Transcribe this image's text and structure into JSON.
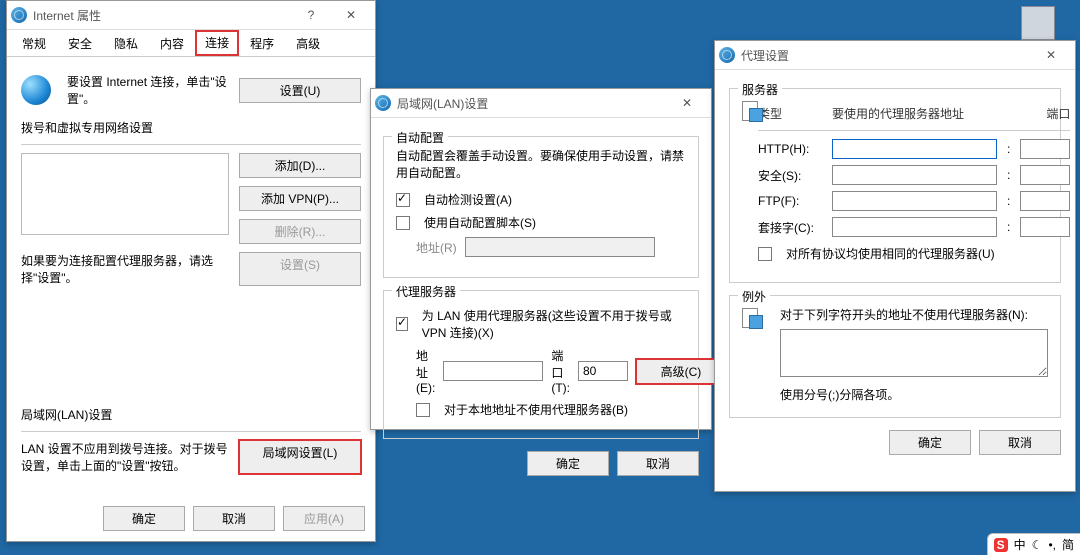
{
  "internet": {
    "title": "Internet 属性",
    "tabs": {
      "general": "常规",
      "security": "安全",
      "privacy": "隐私",
      "content": "内容",
      "connections": "连接",
      "programs": "程序",
      "advanced": "高级"
    },
    "conn_line": "要设置 Internet 连接，单击\"设置\"。",
    "settings_btn": "设置(U)",
    "dial_heading": "拨号和虚拟专用网络设置",
    "add_btn": "添加(D)...",
    "add_vpn_btn": "添加 VPN(P)...",
    "remove_btn": "删除(R)...",
    "settings_s_btn": "设置(S)",
    "proxy_note": "如果要为连接配置代理服务器，请选择\"设置\"。",
    "lan_heading": "局域网(LAN)设置",
    "lan_note": "LAN 设置不应用到拨号连接。对于拨号设置，单击上面的\"设置\"按钮。",
    "lan_btn": "局域网设置(L)",
    "ok": "确定",
    "cancel": "取消",
    "apply": "应用(A)"
  },
  "lan": {
    "title": "局域网(LAN)设置",
    "auto_group": "自动配置",
    "auto_note": "自动配置会覆盖手动设置。要确保使用手动设置，请禁用自动配置。",
    "auto_detect": "自动检测设置(A)",
    "auto_script": "使用自动配置脚本(S)",
    "address_label": "地址(R)",
    "proxy_group": "代理服务器",
    "use_proxy": "为 LAN 使用代理服务器(这些设置不用于拨号或 VPN 连接)(X)",
    "addr_label": "地址(E):",
    "port_label": "端口(T):",
    "port_value": "80",
    "advanced_btn": "高级(C)",
    "bypass": "对于本地地址不使用代理服务器(B)",
    "ok": "确定",
    "cancel": "取消"
  },
  "proxy": {
    "title": "代理设置",
    "server_heading": "服务器",
    "type": "类型",
    "addr_header": "要使用的代理服务器地址",
    "port": "端口",
    "http": "HTTP(H):",
    "secure": "安全(S):",
    "ftp": "FTP(F):",
    "socks": "套接字(C):",
    "same": "对所有协议均使用相同的代理服务器(U)",
    "except_heading": "例外",
    "except_text": "对于下列字符开头的地址不使用代理服务器(N):",
    "hint": "使用分号(;)分隔各项。",
    "ok": "确定",
    "cancel": "取消"
  },
  "ime": {
    "label": "中",
    "sep": "简"
  }
}
